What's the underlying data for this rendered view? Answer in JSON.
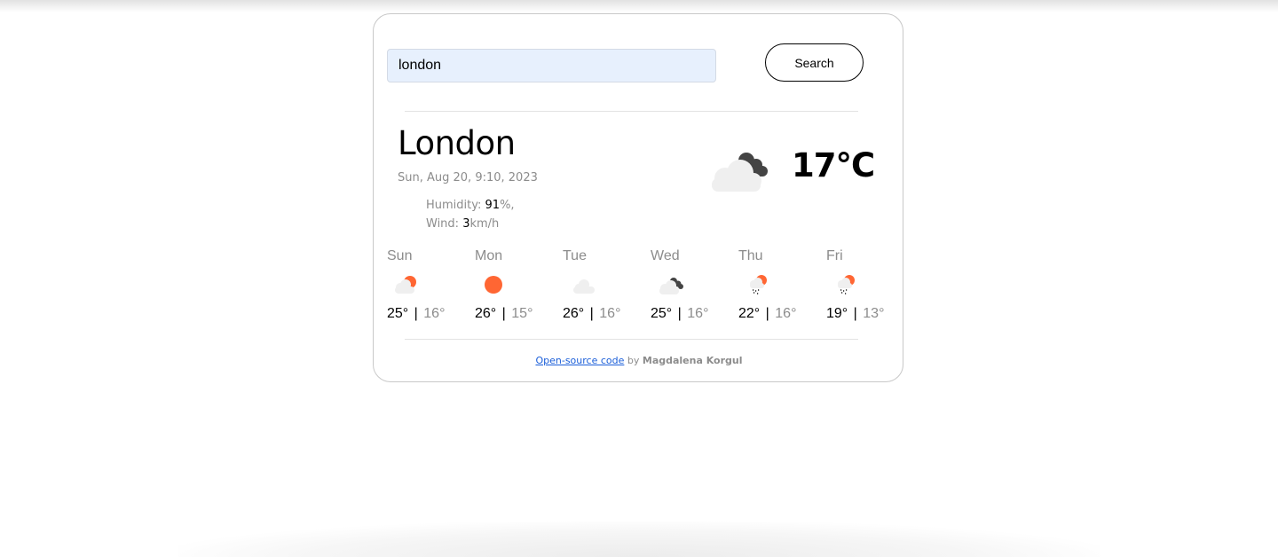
{
  "search": {
    "value": "london",
    "button_label": "Search"
  },
  "current": {
    "city": "London",
    "date": "Sun, Aug 20, 9:10, 2023",
    "humidity_label": "Humidity: ",
    "humidity_value": "91",
    "humidity_unit": "%,",
    "wind_label": "Wind: ",
    "wind_value": "3",
    "wind_unit": "km/h",
    "icon": "broken-clouds-icon",
    "temperature": "17°C"
  },
  "forecast": [
    {
      "day": "Sun",
      "icon": "few-clouds-day-icon",
      "max": "25°",
      "min": "16°"
    },
    {
      "day": "Mon",
      "icon": "clear-sky-day-icon",
      "max": "26°",
      "min": "15°"
    },
    {
      "day": "Tue",
      "icon": "scattered-clouds-icon",
      "max": "26°",
      "min": "16°"
    },
    {
      "day": "Wed",
      "icon": "broken-clouds-icon",
      "max": "25°",
      "min": "16°"
    },
    {
      "day": "Thu",
      "icon": "rain-day-icon",
      "max": "22°",
      "min": "16°"
    },
    {
      "day": "Fri",
      "icon": "rain-day-icon",
      "max": "19°",
      "min": "13°"
    }
  ],
  "forecast_separator": "|",
  "footer": {
    "link_text": "Open-source code",
    "by_text": " by ",
    "author": "Magdalena Korgul"
  },
  "colors": {
    "sun": "#ff6633",
    "light_cloud": "#efefef",
    "dark_cloud": "#444444",
    "link": "#1a5ed9",
    "input_bg": "#e7f0fd"
  }
}
